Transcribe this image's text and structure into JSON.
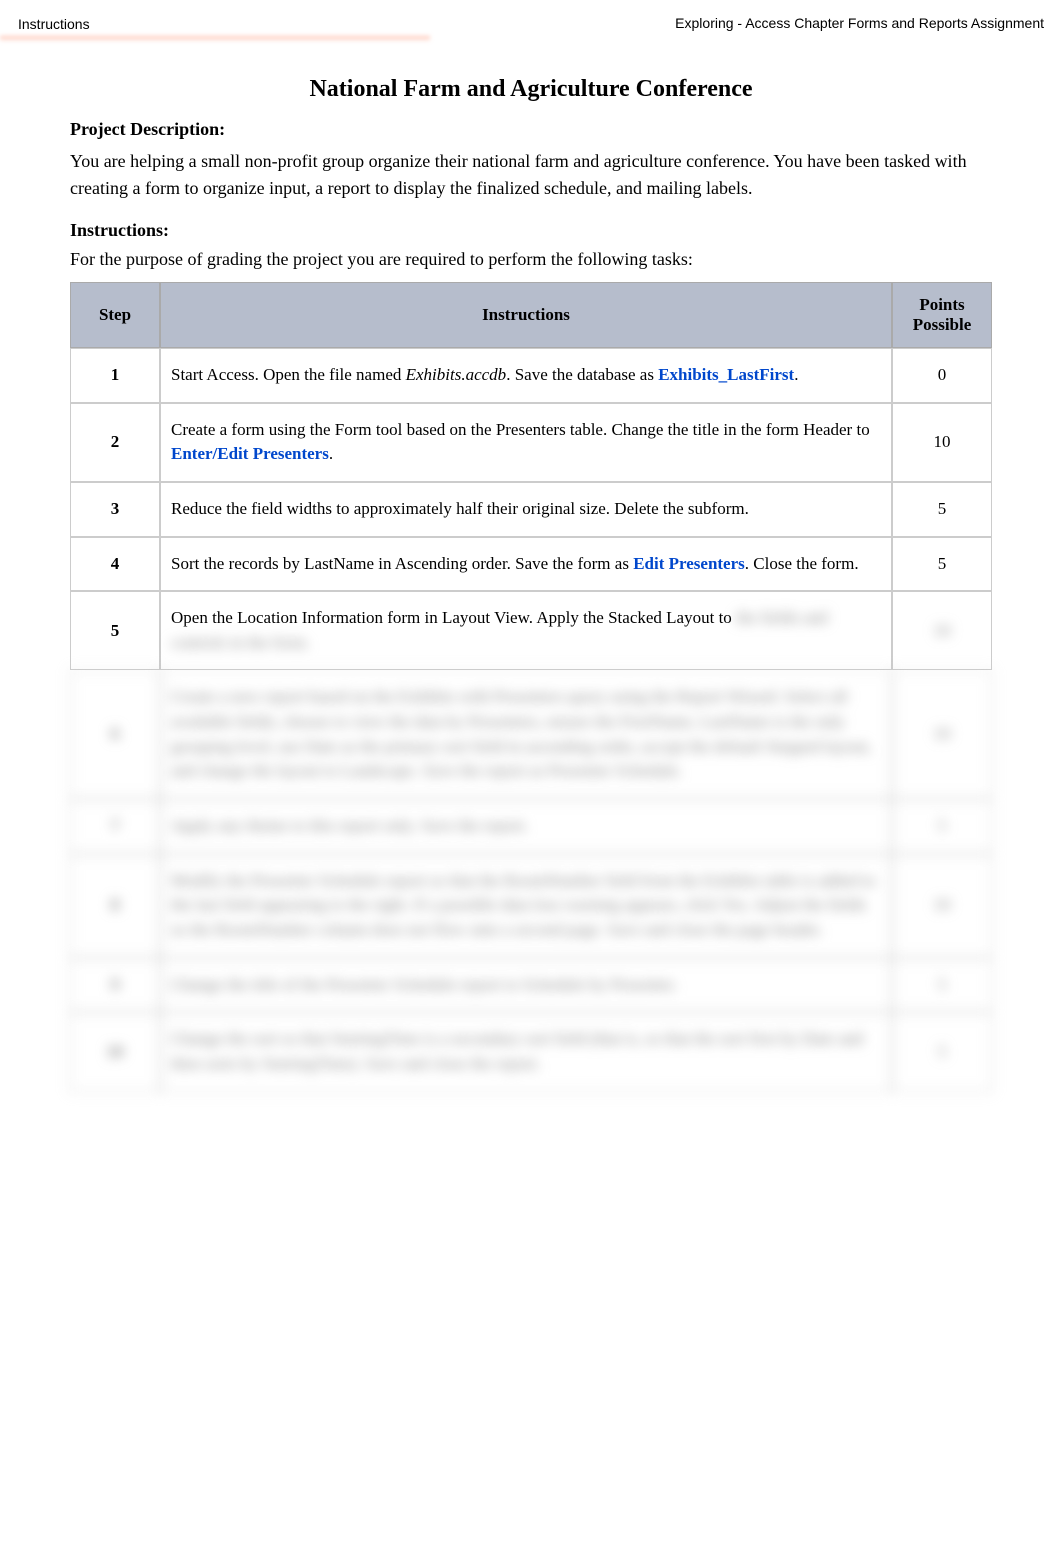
{
  "header": {
    "left": "Instructions",
    "right": "Exploring - Access Chapter Forms and Reports Assignment"
  },
  "title": "National Farm and Agriculture Conference",
  "projectDescHeading": "Project Description:",
  "projectDesc": "You are helping a small non-profit group organize their national farm and agriculture conference. You have been tasked with creating a form to organize input, a report to display the finalized schedule, and mailing labels.",
  "instructionsHeading": "Instructions:",
  "instructionsIntro": "For the purpose of grading the project you are required to perform the following tasks:",
  "table": {
    "headers": {
      "step": "Step",
      "instructions": "Instructions",
      "points": "Points Possible"
    },
    "rows": [
      {
        "step": "1",
        "pre1": "Start Access. Open the file named ",
        "italic": "Exhibits.accdb",
        "mid": ". Save the database as ",
        "blue": "Exhibits_LastFirst",
        "post": ".",
        "points": "0"
      },
      {
        "step": "2",
        "pre1": "Create a form using the Form tool based on the Presenters table. Change the title in the form Header to ",
        "blue": "Enter/Edit Presenters",
        "post": ".",
        "points": "10"
      },
      {
        "step": "3",
        "plain": "Reduce the field widths to approximately half their original size. Delete the subform.",
        "points": "5"
      },
      {
        "step": "4",
        "pre1": "Sort the records by LastName in Ascending order. Save the form as ",
        "blue": "Edit Presenters",
        "post": ". Close the form.",
        "points": "5"
      },
      {
        "step": "5",
        "plain": "Open the Location Information form in Layout View. Apply the Stacked Layout to ",
        "blurTail": "the fields and controls in the form.",
        "points": ""
      }
    ]
  }
}
